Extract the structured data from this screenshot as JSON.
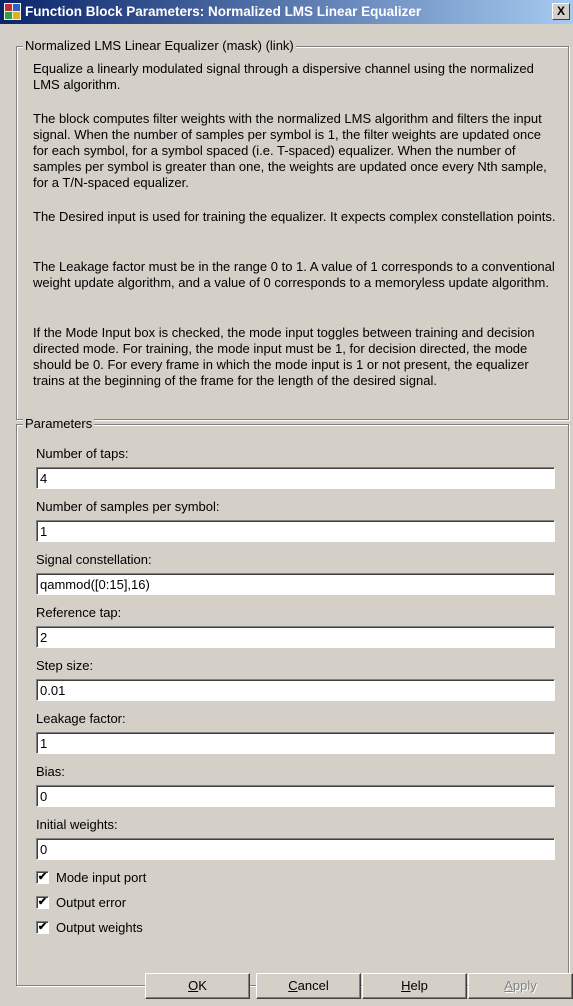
{
  "window": {
    "title": "Function Block Parameters: Normalized LMS  Linear Equalizer",
    "close_label": "X"
  },
  "description": {
    "group_label": "Normalized LMS Linear Equalizer (mask) (link)",
    "paragraphs": [
      "Equalize a linearly modulated signal through a dispersive channel using the normalized LMS algorithm.",
      "The block computes filter weights with the normalized LMS algorithm and filters the input signal. When the number of samples per symbol is 1, the filter weights are updated once for each symbol, for a symbol spaced (i.e. T-spaced) equalizer. When the number of samples per symbol is greater than one, the weights are updated once every Nth sample, for a T/N-spaced equalizer.",
      "The Desired input is used for training the equalizer. It expects complex constellation points.",
      "The Leakage factor must be in the range 0 to 1.  A value of 1 corresponds to a conventional weight update algorithm, and a value of 0 corresponds to a memoryless update algorithm.",
      "If the Mode Input box is checked, the mode input toggles between training and decision directed mode. For training, the mode input must be 1, for decision directed, the mode should be 0. For every frame in which the mode input is 1 or not present, the equalizer trains at the beginning of the frame for the length of the desired signal."
    ]
  },
  "parameters": {
    "group_label": "Parameters",
    "fields": [
      {
        "label": "Number of taps:",
        "value": "4"
      },
      {
        "label": "Number of samples per symbol:",
        "value": "1"
      },
      {
        "label": "Signal constellation:",
        "value": "qammod([0:15],16)"
      },
      {
        "label": "Reference tap:",
        "value": "2"
      },
      {
        "label": "Step size:",
        "value": "0.01"
      },
      {
        "label": "Leakage factor:",
        "value": "1"
      },
      {
        "label": "Bias:",
        "value": "0"
      },
      {
        "label": "Initial weights:",
        "value": "0"
      }
    ],
    "checkboxes": [
      {
        "label": "Mode input port",
        "checked": true
      },
      {
        "label": "Output error",
        "checked": true
      },
      {
        "label": "Output weights",
        "checked": true
      }
    ]
  },
  "buttons": {
    "ok": {
      "label": "OK",
      "mnemonic": "O",
      "rest": "K"
    },
    "cancel": {
      "label": "Cancel",
      "mnemonic": "C",
      "rest": "ancel"
    },
    "help": {
      "label": "Help",
      "mnemonic": "H",
      "rest": "elp"
    },
    "apply": {
      "label": "Apply",
      "mnemonic": "A",
      "rest": "pply"
    }
  },
  "colors": {
    "titlebar_start": "#0a246a",
    "titlebar_end": "#a6caf0",
    "dialog_bg": "#d4d0c8"
  }
}
